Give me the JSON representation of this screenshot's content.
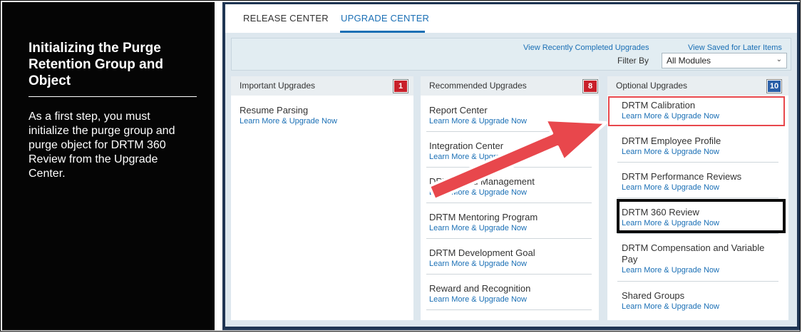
{
  "instructions": {
    "title": "Initializing the Purge Retention Group and Object",
    "body": "As a first step, you must initialize the purge group and purge object for DRTM 360 Review from the Upgrade Center."
  },
  "tabs": [
    {
      "label": "RELEASE CENTER",
      "active": false
    },
    {
      "label": "UPGRADE CENTER",
      "active": true
    }
  ],
  "toolbar": {
    "recent_link": "View Recently Completed Upgrades",
    "saved_link": "View Saved for Later Items",
    "filter_label": "Filter By",
    "filter_value": "All Modules"
  },
  "columns": {
    "important": {
      "title": "Important Upgrades",
      "count": "1",
      "items": [
        {
          "name": "Resume Parsing",
          "link": "Learn More & Upgrade Now"
        }
      ]
    },
    "recommended": {
      "title": "Recommended Upgrades",
      "count": "8",
      "items": [
        {
          "name": "Report Center",
          "link": "Learn More & Upgrade Now"
        },
        {
          "name": "Integration Center",
          "link": "Learn More & Upgrade Now"
        },
        {
          "name": "DRTM Goal Management",
          "link": "Learn More & Upgrade Now"
        },
        {
          "name": "DRTM Mentoring Program",
          "link": "Learn More & Upgrade Now"
        },
        {
          "name": "DRTM Development Goal",
          "link": "Learn More & Upgrade Now"
        },
        {
          "name": "Reward and Recognition",
          "link": "Learn More & Upgrade Now"
        }
      ]
    },
    "optional": {
      "title": "Optional Upgrades",
      "count": "10",
      "items": [
        {
          "name": "DRTM Calibration",
          "link": "Learn More & Upgrade Now"
        },
        {
          "name": "DRTM Employee Profile",
          "link": "Learn More & Upgrade Now"
        },
        {
          "name": "DRTM Performance Reviews",
          "link": "Learn More & Upgrade Now"
        },
        {
          "name": "DRTM 360 Review",
          "link": "Learn More & Upgrade Now"
        },
        {
          "name": "DRTM Compensation and Variable Pay",
          "link": "Learn More & Upgrade Now"
        },
        {
          "name": "Shared Groups",
          "link": "Learn More & Upgrade Now"
        }
      ]
    }
  },
  "colors": {
    "accent": "#1a6fb5",
    "arrow": "#e8474c",
    "badge_red": "#c8202a",
    "badge_blue": "#2a5fa8"
  }
}
